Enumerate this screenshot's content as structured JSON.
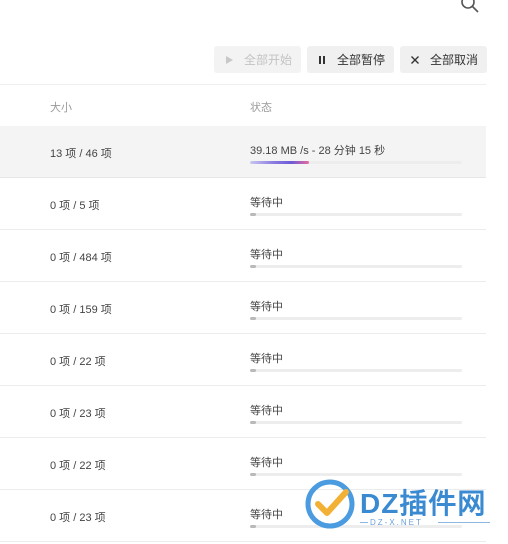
{
  "toolbar": {
    "start_all": "全部开始",
    "pause_all": "全部暂停",
    "cancel_all": "全部取消"
  },
  "columns": {
    "size": "大小",
    "status": "状态"
  },
  "rows": [
    {
      "size": "13 项 / 46 项",
      "status": "39.18 MB /s - 28 分钟 15 秒",
      "progress": 0.28
    },
    {
      "size": "0 项 / 5 项",
      "status": "等待中",
      "progress": 0.03
    },
    {
      "size": "0 项 / 484 项",
      "status": "等待中",
      "progress": 0.03
    },
    {
      "size": "0 项 / 159 项",
      "status": "等待中",
      "progress": 0.03
    },
    {
      "size": "0 项 / 22 项",
      "status": "等待中",
      "progress": 0.03
    },
    {
      "size": "0 项 / 23 项",
      "status": "等待中",
      "progress": 0.03
    },
    {
      "size": "0 项 / 22 项",
      "status": "等待中",
      "progress": 0.03
    },
    {
      "size": "0 项 / 23 项",
      "status": "等待中",
      "progress": 0.03
    }
  ],
  "watermark": {
    "title": "DZ插件网",
    "subtitle": "DZ-X.NET"
  }
}
